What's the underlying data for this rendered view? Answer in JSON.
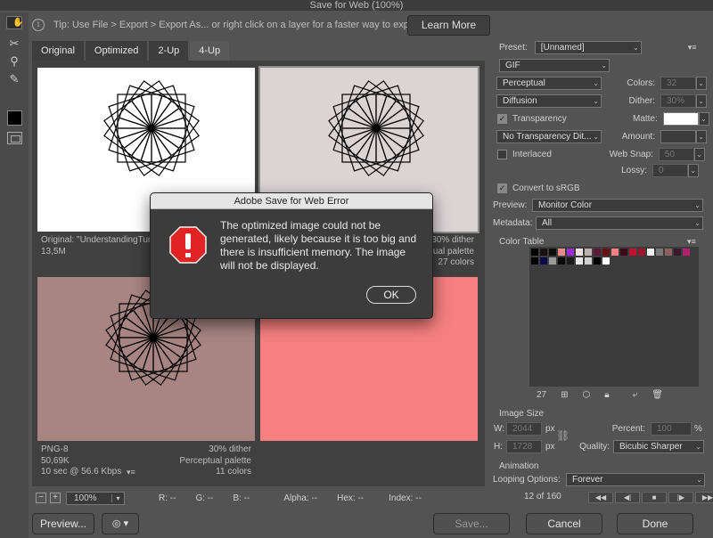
{
  "window": {
    "title": "Save for Web (100%)"
  },
  "tip": {
    "text": "Tip: Use File > Export > Export As... or right click on a layer for a faster way to export assets",
    "learn_more": "Learn More"
  },
  "tabs": [
    {
      "label": "Original"
    },
    {
      "label": "Optimized"
    },
    {
      "label": "2-Up"
    },
    {
      "label": "4-Up"
    }
  ],
  "panes": {
    "original": {
      "line1": "Original: \"UnderstandingTurt",
      "line2": "13,5M",
      "bg": "#ffffff"
    },
    "gif": {
      "right1": "30% dither",
      "right2": "ual palette",
      "right3": "27 colors",
      "bg": "#dcd3d5"
    },
    "png8": {
      "left1": "PNG-8",
      "left2": "50,69K",
      "left3": "10 sec @ 56.6 Kbps",
      "right1": "30% dither",
      "right2": "Perceptual palette",
      "right3": "11 colors",
      "bg": "#a88582"
    },
    "fourth": {
      "bg": "#f68080"
    }
  },
  "status": {
    "zoom": "100%",
    "r": "R: --",
    "g": "G: --",
    "b": "B: --",
    "alpha": "Alpha: --",
    "hex": "Hex: --",
    "index": "Index: --"
  },
  "bottom": {
    "preview": "Preview...",
    "save": "Save...",
    "cancel": "Cancel",
    "done": "Done"
  },
  "settings": {
    "preset_label": "Preset:",
    "preset_value": "[Unnamed]",
    "format": "GIF",
    "reduction": "Perceptual",
    "colors_label": "Colors:",
    "colors_value": "32",
    "dither_algo": "Diffusion",
    "dither_label": "Dither:",
    "dither_value": "30%",
    "transparency": "Transparency",
    "matte_label": "Matte:",
    "transparency_dither": "No Transparency Dit...",
    "amount_label": "Amount:",
    "interlaced": "Interlaced",
    "websnap_label": "Web Snap:",
    "websnap_value": "50",
    "lossy_label": "Lossy:",
    "lossy_value": "0",
    "convert_srgb": "Convert to sRGB",
    "preview_label": "Preview:",
    "preview_value": "Monitor Color",
    "metadata_label": "Metadata:",
    "metadata_value": "All"
  },
  "color_table": {
    "title": "Color Table",
    "count": "27",
    "colors": [
      "#000000",
      "#1a1010",
      "#0d0d0d",
      "#e88a8a",
      "#9b2bd9",
      "#f0e0e0",
      "#bcb0b0",
      "#5a1a3a",
      "#6a1010",
      "#f58080",
      "#3a0a1a",
      "#c01030",
      "#a01030",
      "#f0f0f0",
      "#7a7a7a",
      "#8a6060",
      "#3a1a2a",
      "#b02070",
      "#000000",
      "#0a0a4a",
      "#9a9a9a",
      "#0a0a0a",
      "#1a1a1a",
      "#e8e8e8",
      "#d0d0d0",
      "#000000",
      "#ffffff"
    ]
  },
  "image_size": {
    "title": "Image Size",
    "w_label": "W:",
    "w_value": "2044",
    "h_label": "H:",
    "h_value": "1728",
    "unit": "px",
    "percent_label": "Percent:",
    "percent_value": "100",
    "percent_unit": "%",
    "quality_label": "Quality:",
    "quality_value": "Bicubic Sharper"
  },
  "animation": {
    "title": "Animation",
    "looping_label": "Looping Options:",
    "looping_value": "Forever",
    "frame": "12 of 160"
  },
  "dialog": {
    "title": "Adobe Save for Web Error",
    "message": "The optimized image could not be generated, likely because it is too big and there is insufficient memory. The image will not be displayed.",
    "ok": "OK"
  }
}
